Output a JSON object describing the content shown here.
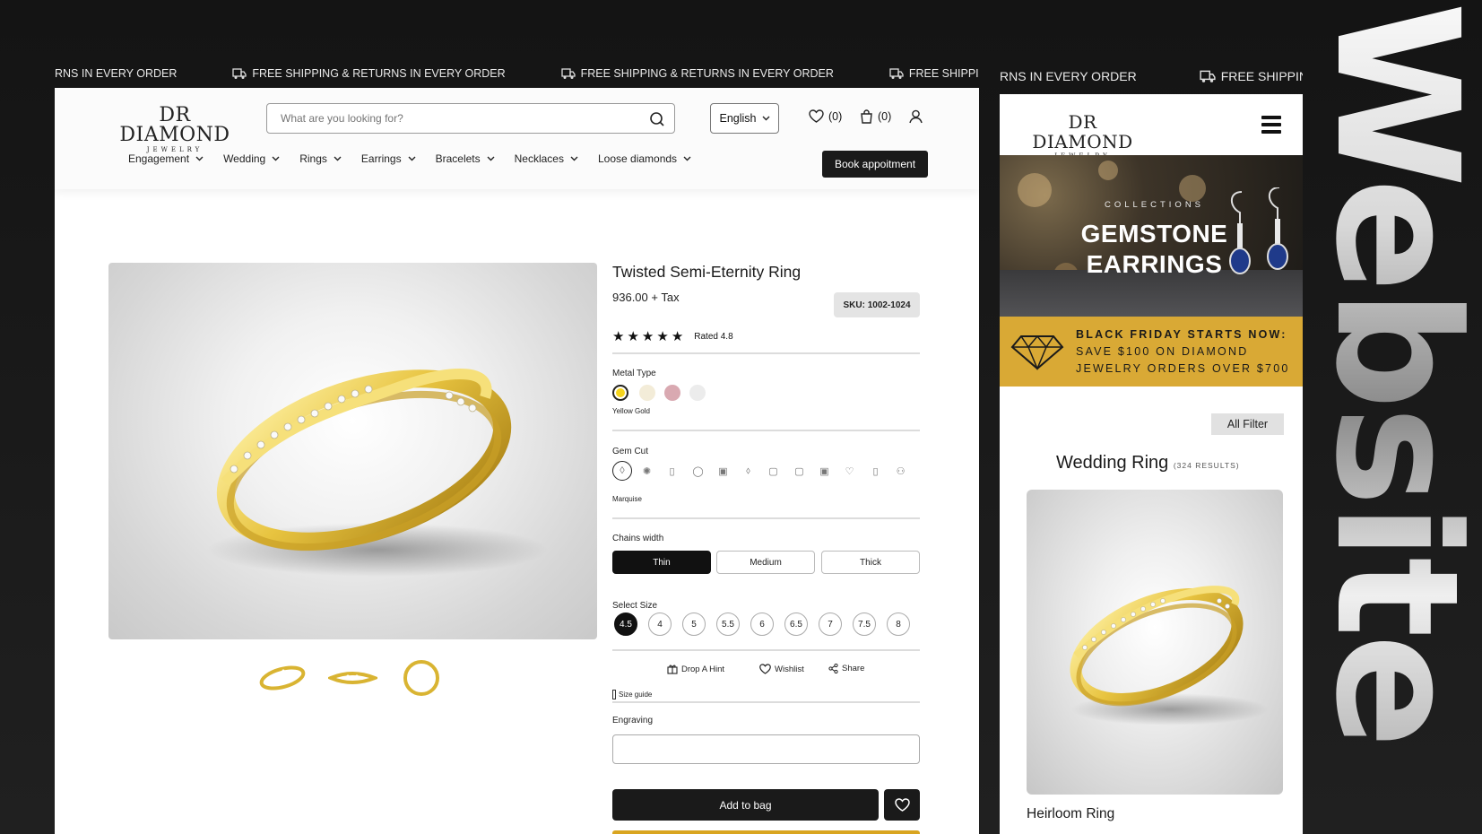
{
  "promo_bar": {
    "items": [
      "RNS IN EVERY ORDER",
      "FREE SHIPPING & RETURNS IN EVERY ORDER",
      "FREE SHIPPING & RETURNS IN EVERY ORDER",
      "FREE SHIPPING & RETURNS IN EVERY"
    ],
    "mobile_items": [
      "RNS IN EVERY ORDER",
      "FREE SHIPPING &"
    ]
  },
  "brand": {
    "logo_main": "DR DIAMOND",
    "logo_sub": "JEWELRY"
  },
  "header": {
    "search_placeholder": "What are you looking for?",
    "language": "English",
    "wishlist_count": "(0)",
    "cart_count": "(0)",
    "nav": [
      "Engagement",
      "Wedding",
      "Rings",
      "Earrings",
      "Bracelets",
      "Necklaces",
      "Loose diamonds"
    ],
    "book_label": "Book appoitment"
  },
  "product": {
    "title": "Twisted Semi-Eternity Ring",
    "price": "936.00 + Tax",
    "sku": "SKU: 1002-1024",
    "rating_text": "Rated 4.8",
    "stars": 5,
    "metal_label": "Metal Type",
    "metal_selected": "Yellow Gold",
    "metal_colors": [
      "#f5d41d",
      "#f3ecd8",
      "#d9a9b1",
      "#ececec"
    ],
    "gem_label": "Gem Cut",
    "gem_selected": "Marquise",
    "gem_icons": [
      "◊",
      "✺",
      "▯",
      "◯",
      "▣",
      "⬨",
      "▢",
      "▢",
      "▣",
      "♡",
      "▯",
      "⚇"
    ],
    "chain_label": "Chains width",
    "chain_options": [
      "Thin",
      "Medium",
      "Thick"
    ],
    "size_label": "Select Size",
    "sizes": [
      "4.5",
      "4",
      "5",
      "5.5",
      "6",
      "6.5",
      "7",
      "7.5",
      "8"
    ],
    "actions": {
      "hint": "Drop A Hint",
      "wishlist": "Wishlist",
      "share": "Share"
    },
    "size_guide": "Size guide",
    "engraving_label": "Engraving",
    "add_to_bag": "Add to bag"
  },
  "mobile": {
    "banner_kicker": "COLLECTIONS",
    "banner_title_1": "GEMSTONE",
    "banner_title_2": "EARRINGS",
    "promo_line_1": "BLACK FRIDAY STARTS NOW:",
    "promo_line_2": "SAVE $100 ON DIAMOND",
    "promo_line_3": "JEWELRY ORDERS OVER $700",
    "filter_label": "All Filter",
    "category_title": "Wedding Ring",
    "results": "(324 RESULTS)",
    "product_name": "Heirloom Ring"
  },
  "side_word": "Website",
  "colors": {
    "accent_gold": "#d9a935",
    "dark": "#1a1a1a"
  }
}
